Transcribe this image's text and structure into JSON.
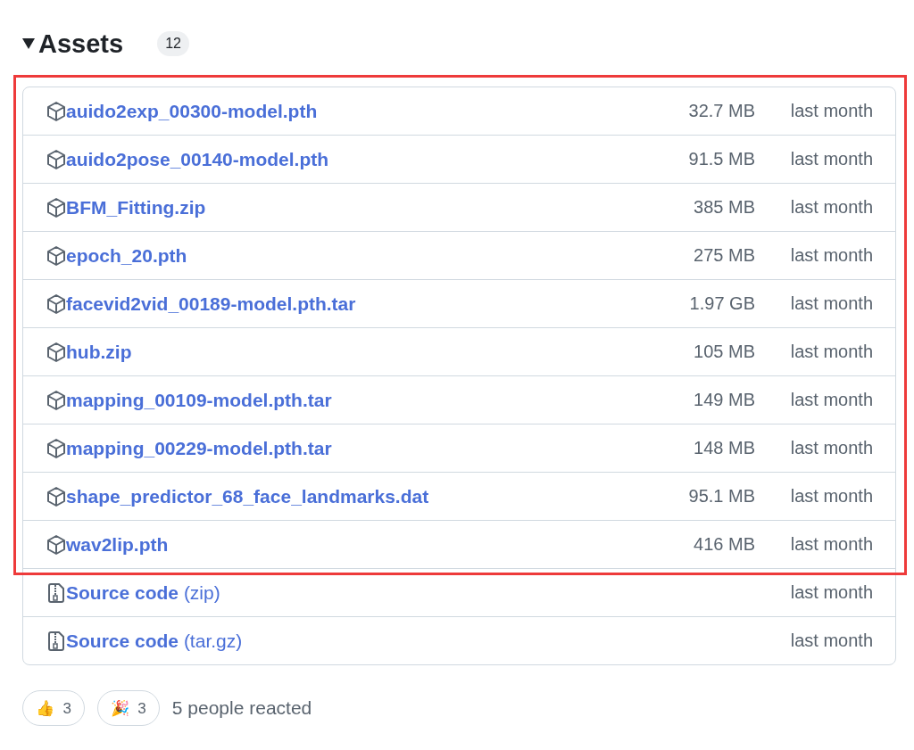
{
  "section": {
    "title": "Assets",
    "count": "12",
    "expanded": true
  },
  "asset_groups": [
    {
      "highlighted": true,
      "items": [
        {
          "kind": "package",
          "name": "auido2exp_00300-model.pth",
          "size": "32.7 MB",
          "date": "last month"
        },
        {
          "kind": "package",
          "name": "auido2pose_00140-model.pth",
          "size": "91.5 MB",
          "date": "last month"
        },
        {
          "kind": "package",
          "name": "BFM_Fitting.zip",
          "size": "385 MB",
          "date": "last month"
        },
        {
          "kind": "package",
          "name": "epoch_20.pth",
          "size": "275 MB",
          "date": "last month"
        },
        {
          "kind": "package",
          "name": "facevid2vid_00189-model.pth.tar",
          "size": "1.97 GB",
          "date": "last month"
        },
        {
          "kind": "package",
          "name": "hub.zip",
          "size": "105 MB",
          "date": "last month"
        },
        {
          "kind": "package",
          "name": "mapping_00109-model.pth.tar",
          "size": "149 MB",
          "date": "last month"
        },
        {
          "kind": "package",
          "name": "mapping_00229-model.pth.tar",
          "size": "148 MB",
          "date": "last month"
        },
        {
          "kind": "package",
          "name": "shape_predictor_68_face_landmarks.dat",
          "size": "95.1 MB",
          "date": "last month"
        },
        {
          "kind": "package",
          "name": "wav2lip.pth",
          "size": "416 MB",
          "date": "last month"
        }
      ]
    },
    {
      "highlighted": false,
      "items": [
        {
          "kind": "source",
          "name": "**Source code** (zip)",
          "date": "last month"
        },
        {
          "kind": "source",
          "name": "**Source code** (tar.gz)",
          "date": "last month"
        }
      ]
    }
  ],
  "reactions": [
    {
      "emoji": "👍",
      "count": "3"
    },
    {
      "emoji": "🎉",
      "count": "3"
    }
  ],
  "reaction_summary": "5 people reacted"
}
